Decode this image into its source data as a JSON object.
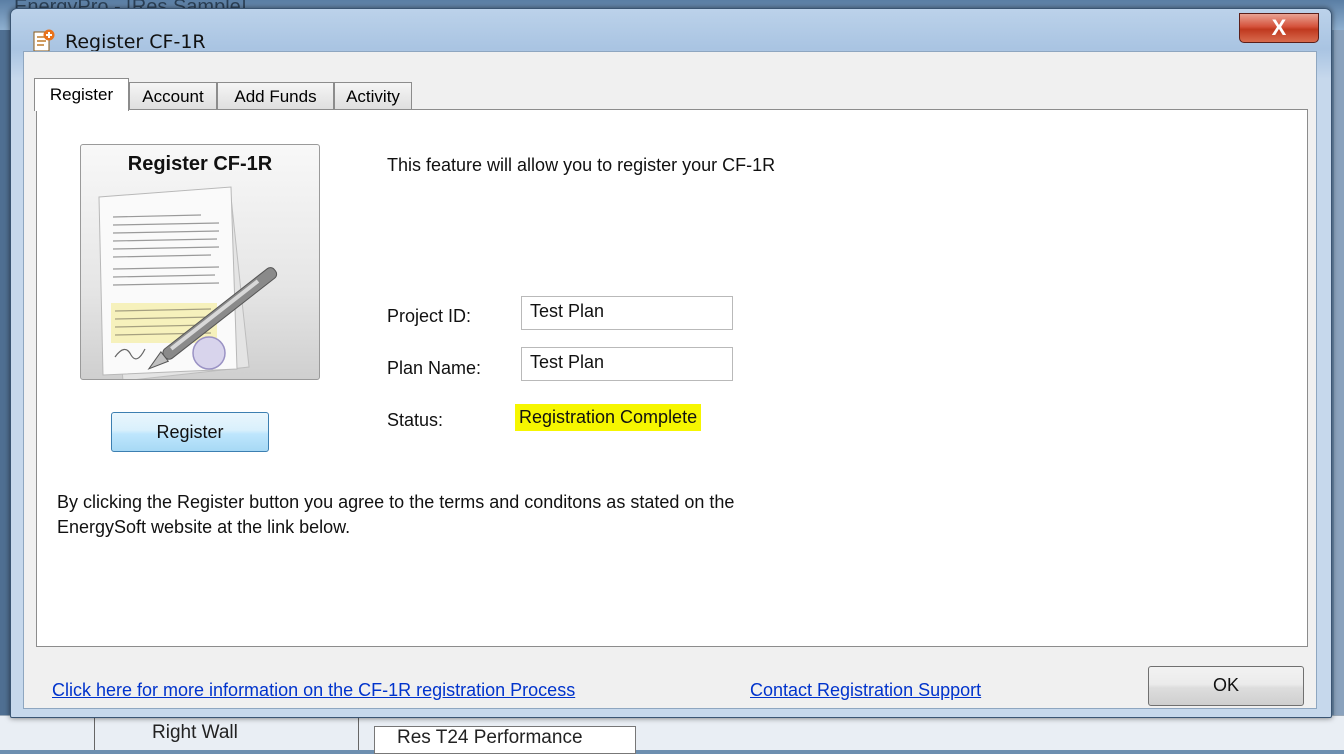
{
  "background": {
    "top_text": "EnergyPro - [Res Sample]",
    "bottom_item": "Right Wall",
    "bottom_box": "Res T24 Performance"
  },
  "window": {
    "title": "Register CF-1R",
    "close_glyph": "X"
  },
  "tabs": [
    {
      "label": "Register",
      "active": true
    },
    {
      "label": "Account",
      "active": false
    },
    {
      "label": "Add Funds",
      "active": false
    },
    {
      "label": "Activity",
      "active": false
    }
  ],
  "illustration": {
    "title": "Register CF-1R"
  },
  "form": {
    "intro": "This feature will allow you to register your CF-1R",
    "project_id_label": "Project ID:",
    "project_id_value": "Test Plan",
    "plan_name_label": "Plan Name:",
    "plan_name_value": "Test Plan",
    "status_label": "Status:",
    "status_value": "Registration Complete",
    "status_highlight_color": "#f6f600"
  },
  "register_button": "Register",
  "terms": "By clicking the Register button you agree to the terms and conditons as stated on the EnergySoft website at the link below.",
  "footer": {
    "info_link": "Click here for more information on the CF-1R registration Process",
    "support_link": "Contact Registration Support",
    "ok_button": "OK"
  }
}
